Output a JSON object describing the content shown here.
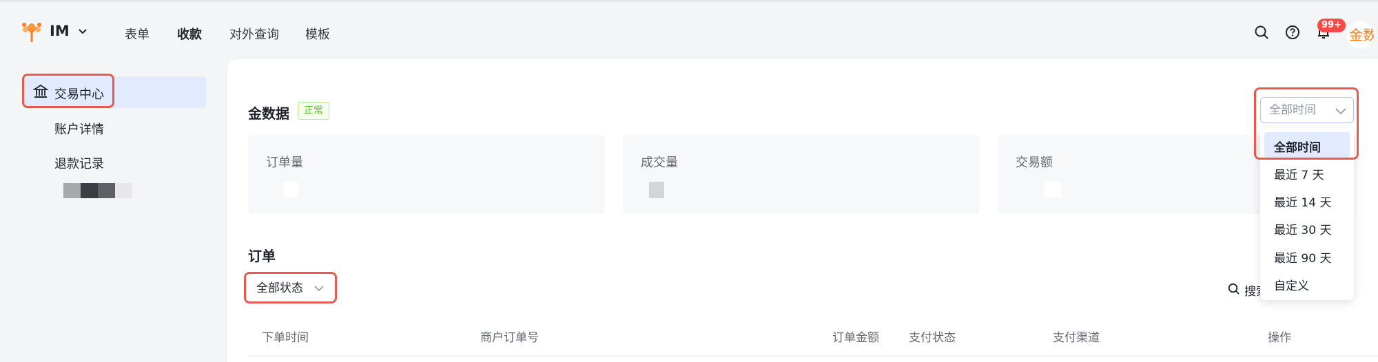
{
  "header": {
    "brand": "IM",
    "nav": [
      "表单",
      "收款",
      "对外查询",
      "模板"
    ],
    "active_nav": "收款",
    "notification_badge": "99+",
    "avatar_text": "金数"
  },
  "sidebar": {
    "items": [
      {
        "label": "交易中心",
        "active": true
      },
      {
        "label": "账户详情",
        "active": false
      },
      {
        "label": "退款记录",
        "active": false
      }
    ]
  },
  "stats": {
    "title": "金数据",
    "status_tag": "正常",
    "cards": [
      {
        "label": "订单量"
      },
      {
        "label": "成交量"
      },
      {
        "label": "交易额"
      }
    ]
  },
  "time_filter": {
    "selected": "全部时间",
    "options": [
      "全部时间",
      "最近 7 天",
      "最近 14 天",
      "最近 30 天",
      "最近 90 天",
      "自定义"
    ]
  },
  "orders": {
    "title": "订单",
    "status_filter": "全部状态",
    "search_label": "搜索",
    "columns": [
      "下单时间",
      "商户订单号",
      "订单金额",
      "支付状态",
      "支付渠道",
      "操作"
    ]
  },
  "colors": {
    "accent": "#3370ff",
    "highlight_box": "#e55b4f",
    "selected_bg": "#e1eaff",
    "status_green": "#52c41a",
    "badge_red": "#f54a45",
    "logo_orange": "#ff7d1a"
  }
}
